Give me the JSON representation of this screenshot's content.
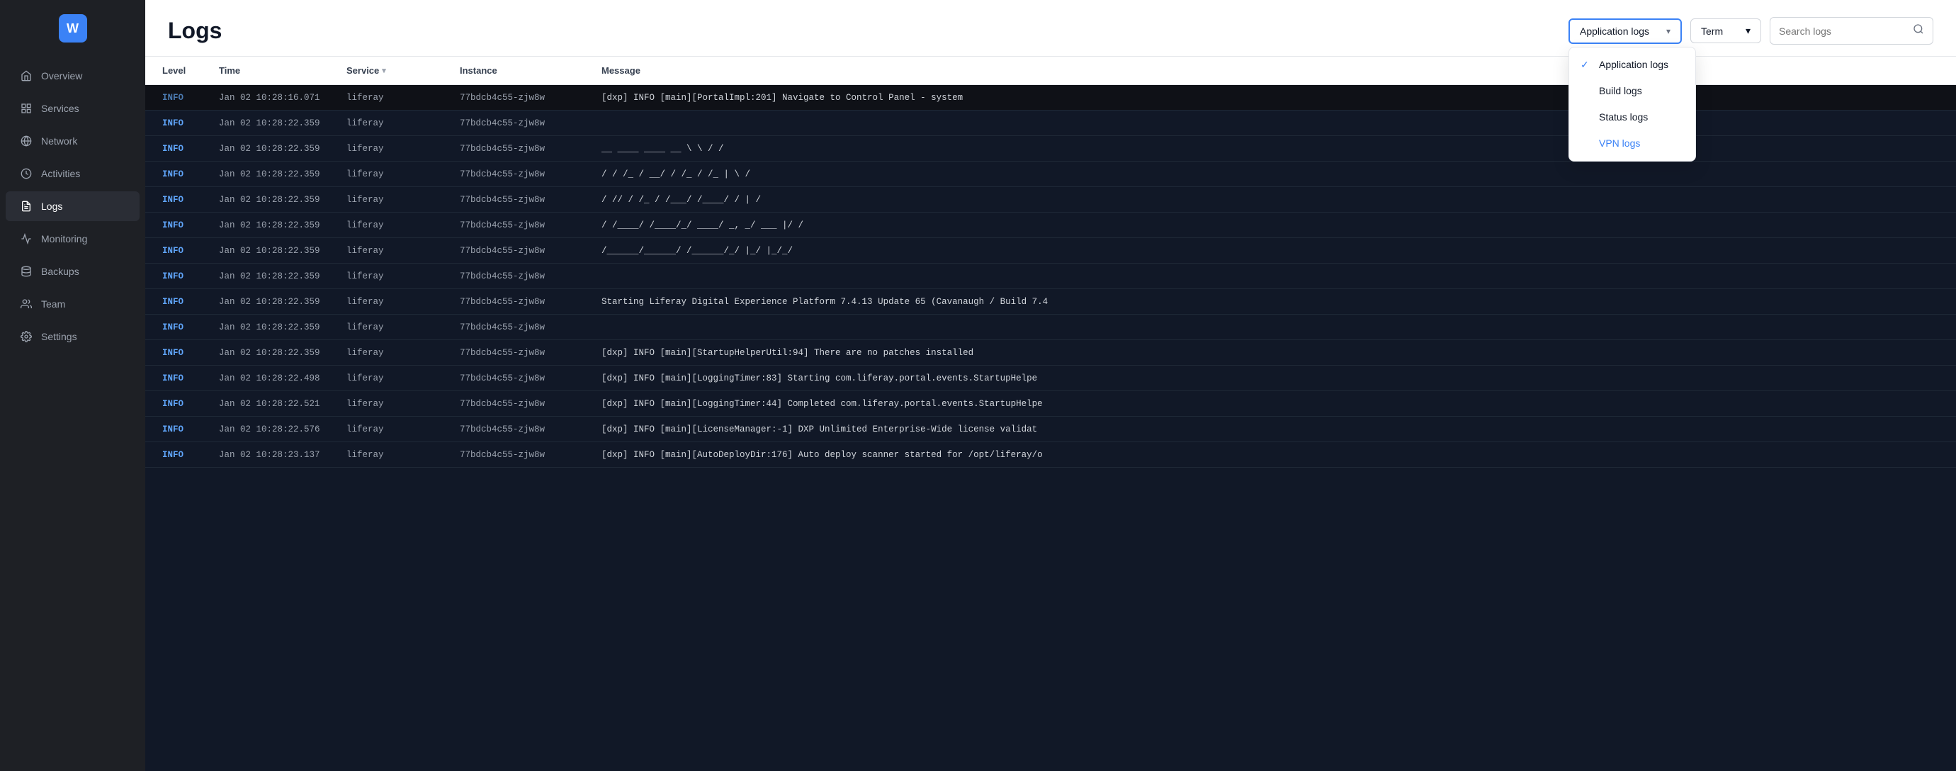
{
  "sidebar": {
    "logo_letter": "W",
    "items": [
      {
        "id": "overview",
        "label": "Overview",
        "icon": "home"
      },
      {
        "id": "services",
        "label": "Services",
        "icon": "grid"
      },
      {
        "id": "network",
        "label": "Network",
        "icon": "globe"
      },
      {
        "id": "activities",
        "label": "Activities",
        "icon": "clock"
      },
      {
        "id": "logs",
        "label": "Logs",
        "icon": "file-text",
        "active": true
      },
      {
        "id": "monitoring",
        "label": "Monitoring",
        "icon": "chart"
      },
      {
        "id": "backups",
        "label": "Backups",
        "icon": "database"
      },
      {
        "id": "team",
        "label": "Team",
        "icon": "users"
      },
      {
        "id": "settings",
        "label": "Settings",
        "icon": "settings"
      }
    ]
  },
  "header": {
    "title": "Logs",
    "dropdown": {
      "selected": "Application logs",
      "options": [
        {
          "id": "application",
          "label": "Application logs",
          "selected": true
        },
        {
          "id": "build",
          "label": "Build logs",
          "selected": false
        },
        {
          "id": "status",
          "label": "Status logs",
          "selected": false
        },
        {
          "id": "vpn",
          "label": "VPN logs",
          "selected": false,
          "accent": true
        }
      ]
    },
    "term_label": "Term",
    "search_placeholder": "Search logs"
  },
  "table": {
    "columns": [
      "Level",
      "Time",
      "Service",
      "Instance",
      "Message"
    ],
    "rows": [
      {
        "level": "INFO",
        "time": "Jan 02 10:28:16.071",
        "service": "liferay",
        "instance": "77bdcb4c55-zjw8w",
        "message": "[dxp] INFO [main][PortalImpl:201] Navigate to Control Panel - system",
        "dimmed": true
      },
      {
        "level": "INFO",
        "time": "Jan 02 10:28:22.359",
        "service": "liferay",
        "instance": "77bdcb4c55-zjw8w",
        "message": "",
        "dimmed": false
      },
      {
        "level": "INFO",
        "time": "Jan 02 10:28:22.359",
        "service": "liferay",
        "instance": "77bdcb4c55-zjw8w",
        "message": "__ ____  ____  __  \\ \\ /  /",
        "dimmed": false
      },
      {
        "level": "INFO",
        "time": "Jan 02 10:28:22.359",
        "service": "liferay",
        "instance": "77bdcb4c55-zjw8w",
        "message": "/ / /_ / __/ / /_ / /_  | \\ /",
        "dimmed": false
      },
      {
        "level": "INFO",
        "time": "Jan 02 10:28:22.359",
        "service": "liferay",
        "instance": "77bdcb4c55-zjw8w",
        "message": "/ //  / /_  / /___/ /____/ / |  /",
        "dimmed": false
      },
      {
        "level": "INFO",
        "time": "Jan 02 10:28:22.359",
        "service": "liferay",
        "instance": "77bdcb4c55-zjw8w",
        "message": "/ /____/ /____/_/  ____/ _, _/ ___ |/ /",
        "dimmed": false
      },
      {
        "level": "INFO",
        "time": "Jan 02 10:28:22.359",
        "service": "liferay",
        "instance": "77bdcb4c55-zjw8w",
        "message": "/______/______/  /______/_/ |_/ |_/_/",
        "dimmed": false
      },
      {
        "level": "INFO",
        "time": "Jan 02 10:28:22.359",
        "service": "liferay",
        "instance": "77bdcb4c55-zjw8w",
        "message": "",
        "dimmed": false
      },
      {
        "level": "INFO",
        "time": "Jan 02 10:28:22.359",
        "service": "liferay",
        "instance": "77bdcb4c55-zjw8w",
        "message": "Starting Liferay Digital Experience Platform 7.4.13 Update 65 (Cavanaugh / Build 7.4",
        "dimmed": false
      },
      {
        "level": "INFO",
        "time": "Jan 02 10:28:22.359",
        "service": "liferay",
        "instance": "77bdcb4c55-zjw8w",
        "message": "",
        "dimmed": false
      },
      {
        "level": "INFO",
        "time": "Jan 02 10:28:22.359",
        "service": "liferay",
        "instance": "77bdcb4c55-zjw8w",
        "message": "[dxp] INFO [main][StartupHelperUtil:94] There are no patches installed",
        "dimmed": false
      },
      {
        "level": "INFO",
        "time": "Jan 02 10:28:22.498",
        "service": "liferay",
        "instance": "77bdcb4c55-zjw8w",
        "message": "[dxp] INFO [main][LoggingTimer:83] Starting com.liferay.portal.events.StartupHelpe",
        "dimmed": false
      },
      {
        "level": "INFO",
        "time": "Jan 02 10:28:22.521",
        "service": "liferay",
        "instance": "77bdcb4c55-zjw8w",
        "message": "[dxp] INFO [main][LoggingTimer:44] Completed com.liferay.portal.events.StartupHelpe",
        "dimmed": false
      },
      {
        "level": "INFO",
        "time": "Jan 02 10:28:22.576",
        "service": "liferay",
        "instance": "77bdcb4c55-zjw8w",
        "message": "[dxp] INFO [main][LicenseManager:-1] DXP Unlimited Enterprise-Wide license validat",
        "dimmed": false
      },
      {
        "level": "INFO",
        "time": "Jan 02 10:28:23.137",
        "service": "liferay",
        "instance": "77bdcb4c55-zjw8w",
        "message": "[dxp] INFO [main][AutoDeployDir:176] Auto deploy scanner started for /opt/liferay/o",
        "dimmed": false
      }
    ]
  },
  "icons": {
    "home": "⌂",
    "grid": "⊞",
    "globe": "◎",
    "clock": "◷",
    "file-text": "☰",
    "chart": "∿",
    "database": "⊟",
    "users": "◉",
    "settings": "⚙",
    "chevron-down": "▾",
    "search": "🔍",
    "check": "✓"
  }
}
